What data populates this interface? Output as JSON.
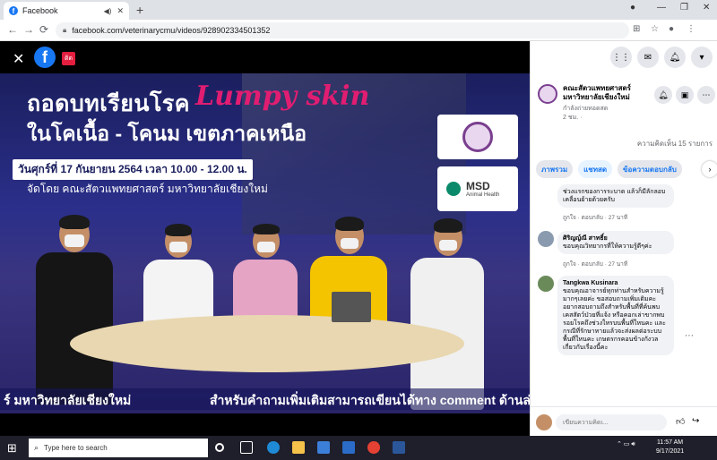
{
  "browser": {
    "tab_title": "Facebook",
    "url": "facebook.com/veterinarycmu/videos/928902334501352"
  },
  "player": {
    "live_badge": "ติด",
    "title_line1": "ถอดบทเรียนโรค",
    "title_script": "Lumpy skin",
    "title_line2": "ในโคเนื้อ - โคนม เขตภาคเหนือ",
    "date_line": "วันศุกร์ที่ 17 กันยายน 2564 เวลา 10.00 - 12.00 น.",
    "organizer": "จัดโดย คณะสัตวแพทยศาสตร์ มหาวิทยาลัยเชียงใหม่",
    "sponsor_name": "MSD",
    "sponsor_sub": "Animal Health",
    "ticker_left": "ร์ มหาวิทยาลัยเชียงใหม่",
    "ticker_right": "สำหรับคำถามเพิ่มเติมสามารถเขียนได้ทาง comment ด้านล่า"
  },
  "sidebar": {
    "page_name": "คณะสัตวแพทยศาสตร์ มหาวิทยาลัยเชียงใหม่",
    "page_live": "กำลังถ่ายทอดสด",
    "page_time": "2 ชม. ·",
    "comment_count": "ความคิดเห็น 15 รายการ",
    "tabs": [
      "ภาพรวม",
      "แชทสด",
      "ข้อความตอบกลับ"
    ],
    "comments": [
      {
        "author": "",
        "text": "ช่วงแรกของการระบาด แล้วก็มีลักลอบเคลื่อนย้ายด้วยครับ",
        "meta": "ถูกใจ · ตอบกลับ · 27 นาที"
      },
      {
        "author": "ศิริญญ์ณี สาทธิ์ย",
        "text": "ขอบคุณวิทยากรที่ให้ความรู้ดีๆค่ะ",
        "meta": "ถูกใจ · ตอบกลับ · 27 นาที"
      },
      {
        "author": "Tangkwa Kusinara",
        "text": "ขอบคุณอาจารย์ทุกท่านสำหรับความรู้มากๆเลยค่ะ ขอสอบถามเพิ่มเติมคะ อยากสอบถามถึงสำหรับพื้นที่ที่ค้นพบเคสสัตว์ป่วยที่แจ้ง หรือคอกเล่าขากพบรอยโรคถึงช่วงใหรบนพื้นที่ใหนคะ และกรณีที่รักษาหายแล้วจะส่งผลต่อระบบพื้นที่ใหนคะ เกษตรกรคอนข้างกังวลเกี่ยวกับเรื่องนี้คะ",
        "meta": ""
      }
    ],
    "comment_placeholder": "เขียนความคิดเ..."
  },
  "taskbar": {
    "search_placeholder": "Type here to search",
    "time": "11:57 AM",
    "date": "9/17/2021"
  }
}
